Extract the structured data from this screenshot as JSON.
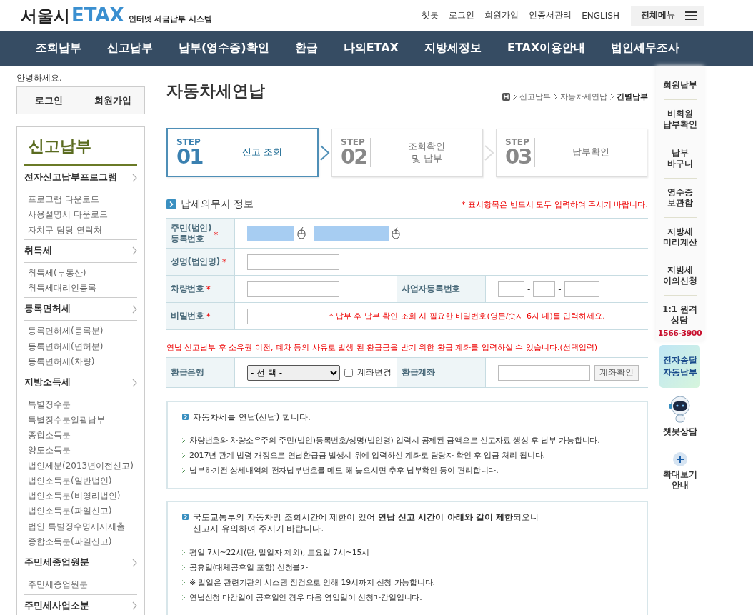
{
  "header": {
    "logo_city": "서울시",
    "logo_brand": "ETAX",
    "tagline": "인터넷 세금납부 시스템",
    "util_links": [
      "챗봇",
      "로그인",
      "회원가입",
      "인증서관리",
      "ENGLISH"
    ],
    "all_menu": "전체메뉴"
  },
  "nav": [
    "조회납부",
    "신고납부",
    "납부(영수증)확인",
    "환급",
    "나의ETAX",
    "지방세정보",
    "ETAX이용안내",
    "법인세무조사"
  ],
  "sidebar": {
    "greeting": "안녕하세요.",
    "auth_buttons": [
      "로그인",
      "회원가입"
    ],
    "title": "신고납부",
    "sections": [
      {
        "label": "전자신고납부프로그램",
        "children": [
          "프로그램 다운로드",
          "사용설명서 다운로드",
          "자치구 담당 연락처"
        ]
      },
      {
        "label": "취득세",
        "children": [
          "취득세(부동산)",
          "취득세대리인등록"
        ]
      },
      {
        "label": "등록면허세",
        "children": [
          "등록면허세(등록분)",
          "등록면허세(면허분)",
          "등록면허세(차량)"
        ]
      },
      {
        "label": "지방소득세",
        "children": [
          "특별징수분",
          "특별징수분일괄납부",
          "종합소득분",
          "양도소득분",
          "법인세분(2013년이전신고)",
          "법인소득분(일반법인)",
          "법인소득분(비영리법인)",
          "법인소득분(파일신고)",
          "법인 특별징수명세서제출",
          "종합소득분(파일신고)"
        ]
      },
      {
        "label": "주민세종업원분",
        "children": [
          "주민세종업원분"
        ]
      },
      {
        "label": "주민세사업소분"
      }
    ]
  },
  "page_title": "자동차세연납",
  "breadcrumb": [
    "신고납부",
    "자동차세연납",
    "건별납부"
  ],
  "steps": [
    {
      "step_label": "STEP",
      "number": "01",
      "label": "신고 조회",
      "selected": true
    },
    {
      "step_label": "STEP",
      "number": "02",
      "label": "조회확인\n및 납부",
      "selected": false
    },
    {
      "step_label": "STEP",
      "number": "03",
      "label": "납부확인",
      "selected": false
    }
  ],
  "section_title": "납세의무자 정보",
  "required_note": "* 표시항목은 반드시 모두 입력하여 주시기 바랍니다.",
  "form_rows": [
    {
      "kind": "id",
      "label": "주민(법인)\n등록번호",
      "required_mark": "*",
      "separator": "-"
    },
    {
      "kind": "text",
      "label": "성명(법인명)",
      "required_mark": "*"
    },
    {
      "kind": "text_biz",
      "label": "차량번호",
      "required_mark": "*",
      "label_2": "사업자등록번호",
      "separators": [
        "-",
        "-"
      ]
    },
    {
      "kind": "password",
      "label": "비밀번호",
      "required_mark": "*",
      "hint": "* 납부 후 납부 확인 조회 시 필요한 비밀번호(영문/숫자 6자 내)를 입력하세요."
    }
  ],
  "refund_note": "연납 신고납부 후 소유권 이전, 폐차 등의 사유로 발생 된 환급금을 받기 위한 환급 계좌를 입력하실 수 있습니다.(선택입력)",
  "refund": {
    "bank_label": "환급은행",
    "bank_select": "- 선 택 -",
    "change_checkbox": {
      "label": "계좌변경",
      "checked": false
    },
    "account_label": "환급계좌",
    "confirm_button": "계좌확인"
  },
  "info_boxes": [
    {
      "heading": "자동차세를 연납(선납) 합니다.",
      "items": [
        "차량번호와 차량소유주의 주민(법인)등록번호/성명(법인명) 입력시 공제된 금액으로 신고자료 생성 후 납부 가능합니다.",
        "2017년 관계 법령 개정으로 연납환급금 발생시 위에 입력하신 계좌로 담당자 확인 후 입금 처리 됩니다.",
        "납부하기전 상세내역의 전자납부번호를 메모 해 놓으시면 추후 납부확인 등이 편리합니다."
      ]
    },
    {
      "heading": "국토교통부의 자동차망 조회시간에 제한이 있어 **연납 신고 시간이 아래와 같이 제한**되오니\n신고시 유의하여 주시기 바랍니다.",
      "items": [
        "평일 7시~22시(단, 말일자 제외), 토요일 7시~15시",
        "공휴일(대체공휴일 포함) 신청불가",
        "※ 말일은 관련기관의 시스템 점검으로 인해 19시까지 신청 가능합니다.",
        "연납신청 마감일이 공휴일인 경우 다음 영업일이 신청마감일입니다."
      ]
    }
  ],
  "quick_menu": {
    "items": [
      "회원납부",
      "비회원\n납부확인",
      "납부\n바구니",
      "영수증\n보관함",
      "지방세\n미리계산",
      "지방세\n이의신청",
      "1:1 원격\n상담"
    ],
    "phone": "1566-3900",
    "edelivery": "전자송달\n자동납부",
    "chatbot": "챗봇상담",
    "zoom": "확대보기\n안내"
  }
}
